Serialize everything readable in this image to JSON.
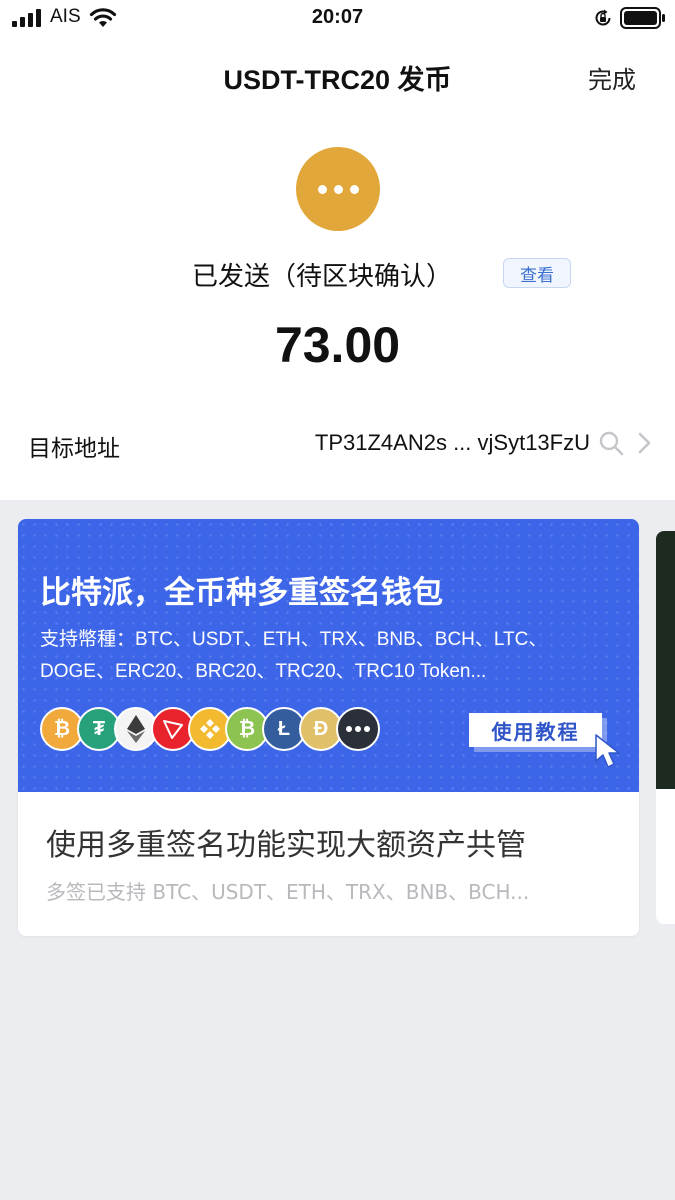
{
  "status_bar": {
    "carrier": "AIS",
    "time": "20:07"
  },
  "nav": {
    "title": "USDT-TRC20 发币",
    "done_label": "完成"
  },
  "transaction": {
    "status_text": "已发送（待区块确认）",
    "view_label": "查看",
    "amount": "73.00",
    "address_label": "目标地址",
    "address_value": "TP31Z4AN2s ... vjSyt13FzU"
  },
  "card": {
    "banner_title": "比特派，全币种多重签名钱包",
    "banner_line1": "支持幣種：BTC、USDT、ETH、TRX、BNB、BCH、LTC、",
    "banner_line2": "DOGE、ERC20、BRC20、TRC20、TRC10 Token...",
    "tutorial_label": "使用教程",
    "title": "使用多重签名功能实现大额资产共管",
    "subtitle": "多签已支持 BTC、USDT、ETH、TRX、BNB、BCH...",
    "coins": [
      "bitcoin-icon",
      "tether-icon",
      "ethereum-icon",
      "tron-icon",
      "bnb-icon",
      "bitcoin-cash-icon",
      "litecoin-icon",
      "dogecoin-icon",
      "more-icon"
    ]
  },
  "colors": {
    "status_icon": "#e2a73b",
    "banner": "#3d65e8",
    "link_blue": "#3a6fcf"
  }
}
